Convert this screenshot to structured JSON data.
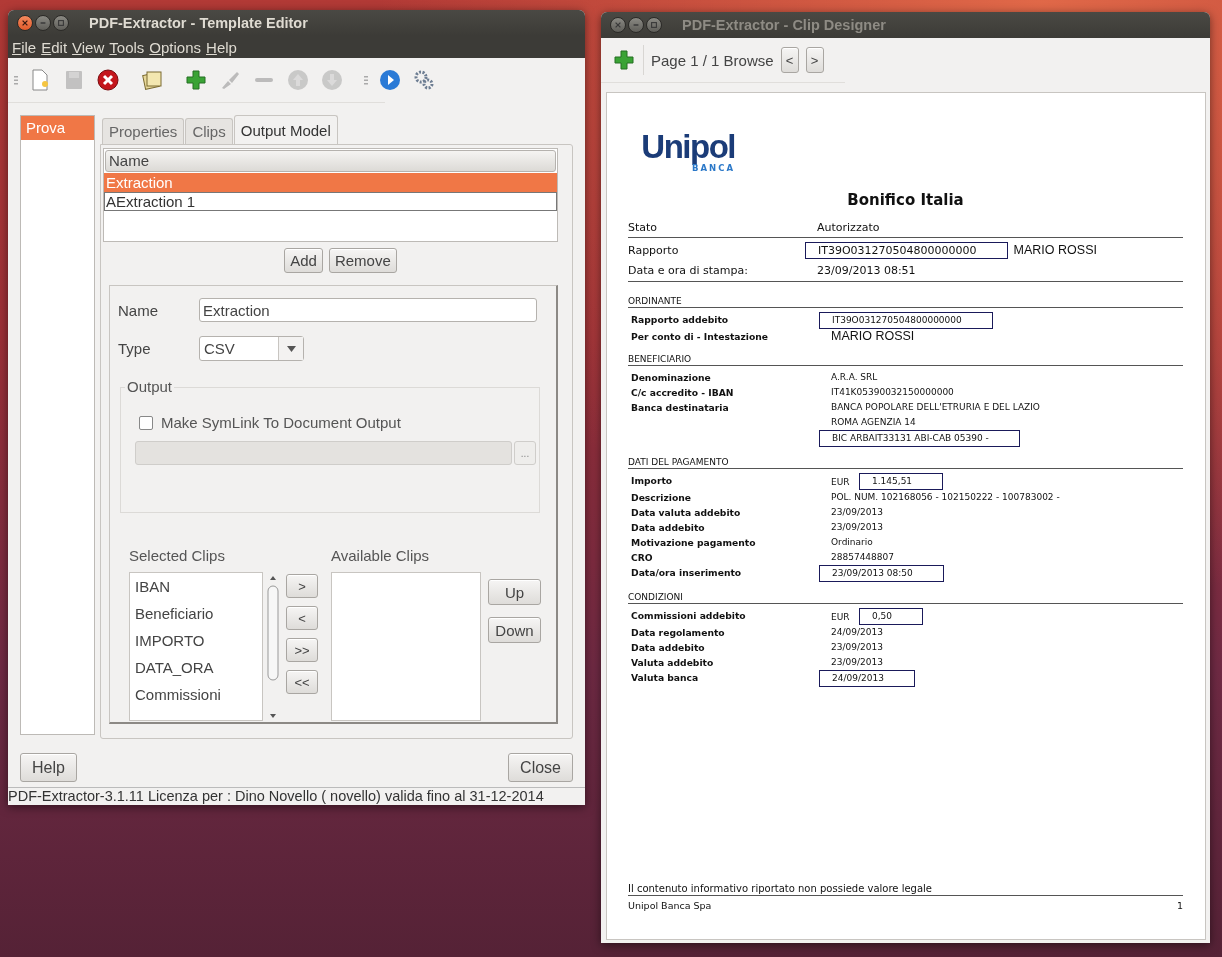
{
  "template_editor": {
    "title": "PDF-Extractor - Template Editor",
    "menu": [
      "File",
      "Edit",
      "View",
      "Tools",
      "Options",
      "Help"
    ],
    "toolbar": [
      {
        "kind": "new",
        "disabled": false
      },
      {
        "kind": "save",
        "disabled": true
      },
      {
        "kind": "delete",
        "disabled": false
      },
      {
        "kind": "sep"
      },
      {
        "kind": "template",
        "disabled": false
      },
      {
        "kind": "sep"
      },
      {
        "kind": "add",
        "disabled": false
      },
      {
        "kind": "brush",
        "disabled": true
      },
      {
        "kind": "minus",
        "disabled": true
      },
      {
        "kind": "up",
        "disabled": true
      },
      {
        "kind": "down",
        "disabled": true
      },
      {
        "kind": "grip"
      },
      {
        "kind": "run",
        "disabled": false
      },
      {
        "kind": "settings",
        "disabled": false
      }
    ],
    "templates": [
      {
        "label": "Prova",
        "selected": true
      }
    ],
    "tabs": [
      {
        "label": "Properties",
        "selected": false
      },
      {
        "label": "Clips",
        "selected": false
      },
      {
        "label": "Output Model",
        "selected": true
      }
    ],
    "models": {
      "column": "Name",
      "rows": [
        {
          "name": "Extraction",
          "selected": true
        },
        {
          "name": "AExtraction 1",
          "selected": false
        }
      ],
      "buttons": [
        "Add",
        "Remove"
      ]
    },
    "form": {
      "name_label": "Name",
      "name_value": "Extraction",
      "type_label": "Type",
      "type_value": "CSV",
      "output": {
        "legend": "Output",
        "symlink": {
          "label": "Make SymLink To Document Output",
          "checked": false
        },
        "browse": "..."
      },
      "selected_label": "Selected Clips",
      "selected_clips": [
        "IBAN",
        "Beneficiario",
        "IMPORTO",
        "DATA_ORA",
        "Commissioni"
      ],
      "move_buttons": [
        ">",
        "<",
        ">>",
        "<<"
      ],
      "available_label": "Available Clips",
      "order_buttons": [
        "Up",
        "Down"
      ]
    },
    "bottom_buttons": [
      "Help",
      "Close"
    ],
    "status": "PDF-Extractor-3.1.11  Licenza per : Dino Novello ( novello) valida fino al 31-12-2014"
  },
  "clip_designer": {
    "title": "PDF-Extractor - Clip Designer",
    "page_label": "Page 1 / 1 Browse",
    "nav": [
      "<",
      ">"
    ],
    "document": {
      "logo": "Unipol",
      "logo_sub": "BANCA",
      "title": "Bonifico Italia",
      "summary": [
        {
          "label": "Stato",
          "lines": [
            {
              "text": "Autorizzato",
              "boxed": false
            }
          ]
        },
        {
          "label": "Rapporto",
          "lines": [
            {
              "text": "IT39O031270504800000000",
              "boxed": true,
              "extra": "MARIO ROSSI"
            }
          ]
        },
        {
          "label": "Data e ora di stampa:",
          "lines": [
            {
              "text": "23/09/2013 08:51",
              "boxed": false
            }
          ]
        }
      ],
      "sections": [
        {
          "heading": "ORDINANTE",
          "rows": [
            {
              "label": "Rapporto addebito",
              "lines": [
                {
                  "text": "IT39O031270504800000000",
                  "boxed": true
                }
              ]
            },
            {
              "label": "Per conto di - Intestazione",
              "lines": [
                {
                  "text": "MARIO ROSSI",
                  "boxed": false,
                  "large": true
                }
              ]
            }
          ]
        },
        {
          "heading": "BENEFICIARIO",
          "rows": [
            {
              "label": "Denominazione",
              "lines": [
                {
                  "text": "A.R.A. SRL",
                  "boxed": false
                }
              ]
            },
            {
              "label": "C/c accredito - IBAN",
              "lines": [
                {
                  "text": "IT41K05390032150000000",
                  "boxed": false
                }
              ]
            },
            {
              "label": "Banca destinataria",
              "lines": [
                {
                  "text": "BANCA POPOLARE DELL'ETRURIA E DEL LAZIO",
                  "boxed": false
                },
                {
                  "text": "ROMA AGENZIA 14",
                  "boxed": false
                },
                {
                  "text": "BIC ARBAIT33131 ABI-CAB 05390 -",
                  "boxed": true
                }
              ]
            }
          ]
        },
        {
          "heading": "DATI DEL PAGAMENTO",
          "rows": [
            {
              "label": "Importo",
              "lines": [
                {
                  "prefix": "EUR",
                  "text": "1.145,51",
                  "boxed": true
                }
              ]
            },
            {
              "label": "Descrizione",
              "lines": [
                {
                  "text": "POL. NUM. 102168056 - 102150222 - 100783002 -",
                  "boxed": false
                }
              ]
            },
            {
              "label": "Data valuta addebito",
              "lines": [
                {
                  "text": "23/09/2013",
                  "boxed": false
                }
              ]
            },
            {
              "label": "Data addebito",
              "lines": [
                {
                  "text": "23/09/2013",
                  "boxed": false
                }
              ]
            },
            {
              "label": "Motivazione pagamento",
              "lines": [
                {
                  "text": "Ordinario",
                  "boxed": false
                }
              ]
            },
            {
              "label": "CRO",
              "lines": [
                {
                  "text": "28857448807",
                  "boxed": false
                }
              ]
            },
            {
              "label": "Data/ora inserimento",
              "lines": [
                {
                  "text": "23/09/2013 08:50",
                  "boxed": true
                }
              ]
            }
          ]
        },
        {
          "heading": "CONDIZIONI",
          "rows": [
            {
              "label": "Commissioni addebito",
              "lines": [
                {
                  "prefix": "EUR",
                  "text": "0,50",
                  "boxed": true
                }
              ]
            },
            {
              "label": "Data regolamento",
              "lines": [
                {
                  "text": "24/09/2013",
                  "boxed": false
                }
              ]
            },
            {
              "label": "Data addebito",
              "lines": [
                {
                  "text": "23/09/2013",
                  "boxed": false
                }
              ]
            },
            {
              "label": "Valuta addebito",
              "lines": [
                {
                  "text": "23/09/2013",
                  "boxed": false
                }
              ]
            },
            {
              "label": "Valuta banca",
              "lines": [
                {
                  "text": "24/09/2013",
                  "boxed": true
                }
              ]
            }
          ]
        }
      ],
      "note": "Il contenuto informativo riportato non possiede valore legale",
      "company": "Unipol Banca Spa",
      "page_number": "1"
    }
  }
}
